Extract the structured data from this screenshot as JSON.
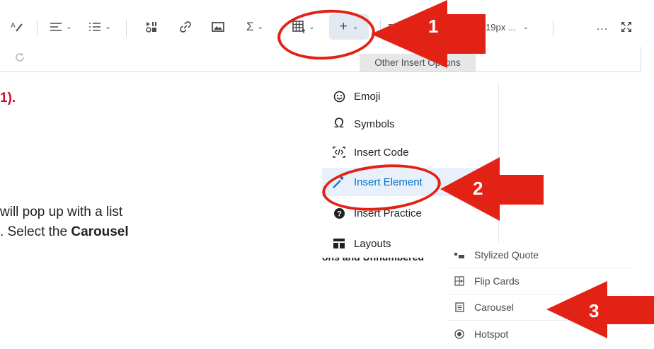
{
  "toolbar": {
    "font_dropdown_fragment": "Pa",
    "size_dropdown_value": "19px ...",
    "more_label": "...",
    "plus_label": "+"
  },
  "tooltip": {
    "text": "Other Insert Options"
  },
  "doc": {
    "step_ref": "1).",
    "line1": "will pop up with a list",
    "line2_prefix": ". Select the ",
    "line2_bold": "Carousel",
    "line3": "ons and Unnumbered"
  },
  "menu": {
    "items": [
      {
        "label": "Emoji",
        "icon": "emoji-icon"
      },
      {
        "label": "Symbols",
        "icon": "omega-icon"
      },
      {
        "label": "Insert Code",
        "icon": "code-icon"
      },
      {
        "label": "Insert Element",
        "icon": "magic-wand-icon",
        "active": true
      },
      {
        "label": "Insert Practice",
        "icon": "question-icon"
      },
      {
        "label": "Layouts",
        "icon": "layout-icon"
      }
    ]
  },
  "submenu": {
    "items": [
      {
        "label": "Stylized Quote",
        "icon": "quote-icon"
      },
      {
        "label": "Flip Cards",
        "icon": "flip-cards-icon"
      },
      {
        "label": "Carousel",
        "icon": "carousel-icon"
      },
      {
        "label": "Hotspot",
        "icon": "hotspot-icon"
      }
    ]
  },
  "annotations": {
    "badge1": "1",
    "badge2": "2",
    "badge3": "3",
    "color": "#e32216"
  }
}
